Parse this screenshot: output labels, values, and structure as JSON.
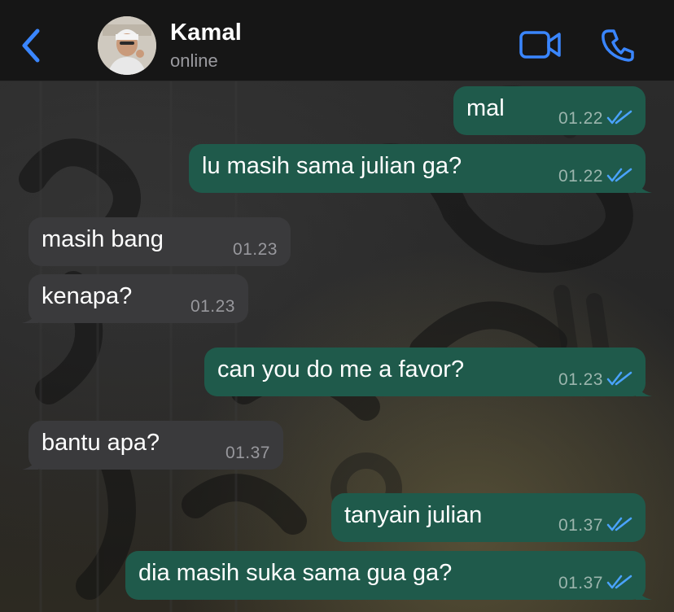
{
  "header": {
    "contact_name": "Kamal",
    "status": "online",
    "back_icon": "chevron-left-icon",
    "video_icon": "video-camera-icon",
    "call_icon": "phone-icon",
    "accent_color": "#3a86ff"
  },
  "messages": [
    {
      "direction": "out",
      "text": "mal",
      "time": "01.22",
      "read": true
    },
    {
      "direction": "out",
      "text": "lu masih sama julian ga?",
      "time": "01.22",
      "read": true
    },
    {
      "direction": "in",
      "text": "masih bang",
      "time": "01.23"
    },
    {
      "direction": "in",
      "text": "kenapa?",
      "time": "01.23"
    },
    {
      "direction": "out",
      "text": "can you do me a favor?",
      "time": "01.23",
      "read": true
    },
    {
      "direction": "in",
      "text": "bantu apa?",
      "time": "01.37"
    },
    {
      "direction": "out",
      "text": "tanyain julian",
      "time": "01.37",
      "read": true
    },
    {
      "direction": "out",
      "text": "dia masih suka sama gua ga?",
      "time": "01.37",
      "read": true
    }
  ],
  "colors": {
    "outgoing_bubble": "#1f5a4b",
    "incoming_bubble": "#3a3a3c",
    "read_ticks": "#4aa3ff"
  }
}
